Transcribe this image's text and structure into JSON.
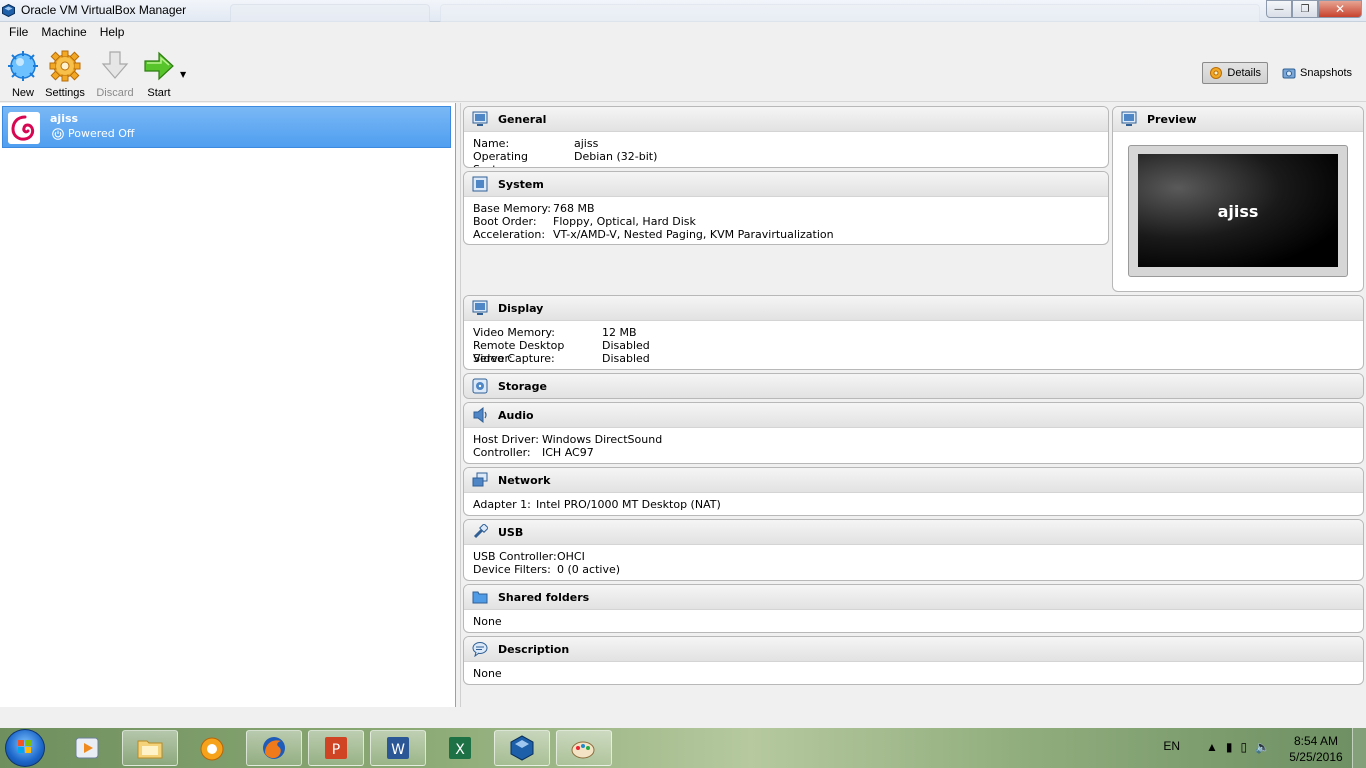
{
  "window": {
    "title": "Oracle VM VirtualBox Manager",
    "controls": {
      "minimize": "—",
      "maximize": "❐",
      "close": "✕"
    }
  },
  "menu": [
    "File",
    "Machine",
    "Help"
  ],
  "toolbar": {
    "new": "New",
    "settings": "Settings",
    "discard": "Discard",
    "start": "Start",
    "details": "Details",
    "snapshots": "Snapshots"
  },
  "vm": {
    "name": "ajiss",
    "state": "Powered Off"
  },
  "general": {
    "title": "General",
    "name_k": "Name:",
    "name_v": "ajiss",
    "os_k": "Operating System:",
    "os_v": "Debian (32-bit)"
  },
  "system": {
    "title": "System",
    "mem_k": "Base Memory:",
    "mem_v": "768 MB",
    "boot_k": "Boot Order:",
    "boot_v": "Floppy, Optical, Hard Disk",
    "acc_k": "Acceleration:",
    "acc_v": "VT-x/AMD-V, Nested Paging, KVM Paravirtualization"
  },
  "preview": {
    "title": "Preview",
    "screen_text": "ajiss"
  },
  "display": {
    "title": "Display",
    "vmem_k": "Video Memory:",
    "vmem_v": "12 MB",
    "rds_k": "Remote Desktop Server:",
    "rds_v": "Disabled",
    "cap_k": "Video Capture:",
    "cap_v": "Disabled"
  },
  "storage": {
    "title": "Storage"
  },
  "audio": {
    "title": "Audio",
    "host_k": "Host Driver:",
    "host_v": "Windows DirectSound",
    "ctrl_k": "Controller:",
    "ctrl_v": "ICH AC97"
  },
  "network": {
    "title": "Network",
    "ad_k": "Adapter 1:",
    "ad_v": "Intel PRO/1000 MT Desktop (NAT)"
  },
  "usb": {
    "title": "USB",
    "ctrl_k": "USB Controller:",
    "ctrl_v": "OHCI",
    "flt_k": "Device Filters:",
    "flt_v": "0 (0 active)"
  },
  "shared": {
    "title": "Shared folders",
    "value": "None"
  },
  "description": {
    "title": "Description",
    "value": "None"
  },
  "taskbar": {
    "apps": [
      "media-player-icon",
      "file-explorer-icon",
      "browser-icon",
      "firefox-icon",
      "powerpoint-icon",
      "word-icon",
      "excel-icon",
      "virtualbox-icon",
      "paint-icon"
    ],
    "lang": "EN",
    "time": "8:54 AM",
    "date": "5/25/2016"
  },
  "colors": {
    "selection": "#4f9ef0",
    "accent": "#1b66c9"
  }
}
